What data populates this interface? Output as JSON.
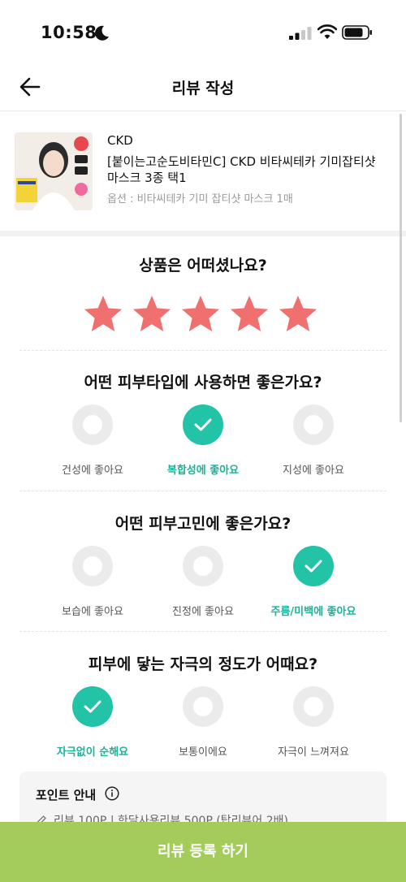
{
  "status_bar": {
    "time": "10:58"
  },
  "header": {
    "title": "리뷰 작성"
  },
  "product": {
    "brand": "CKD",
    "name": "[붙이는고순도비타민C] CKD 비타씨테카 기미잡티샷 마스크 3종 택1",
    "option": "옵션 : 비타씨테카 기미 잡티샷 마스크 1매"
  },
  "rating": {
    "question": "상품은 어떠셨나요?",
    "stars_selected": 5,
    "stars_total": 5,
    "star_color": "#f07070"
  },
  "skin_type": {
    "question": "어떤 피부타입에 사용하면 좋은가요?",
    "options": [
      "건성에 좋아요",
      "복합성에 좋아요",
      "지성에 좋아요"
    ],
    "selected": 1
  },
  "skin_concern": {
    "question": "어떤 피부고민에 좋은가요?",
    "options": [
      "보습에 좋아요",
      "진정에 좋아요",
      "주름/미백에 좋아요"
    ],
    "selected": 2
  },
  "irritation": {
    "question": "피부에 닿는 자극의 정도가 어때요?",
    "options": [
      "자극없이 순해요",
      "보통이에요",
      "자극이 느껴져요"
    ],
    "selected": 0
  },
  "point_info": {
    "title": "포인트 안내",
    "line": "리뷰 100P | 한달사용리뷰 500P (탑리뷰어 2배)"
  },
  "submit": {
    "label": "리뷰 등록 하기",
    "color": "#a3cc5a"
  },
  "colors": {
    "accent": "#23c3a8"
  }
}
